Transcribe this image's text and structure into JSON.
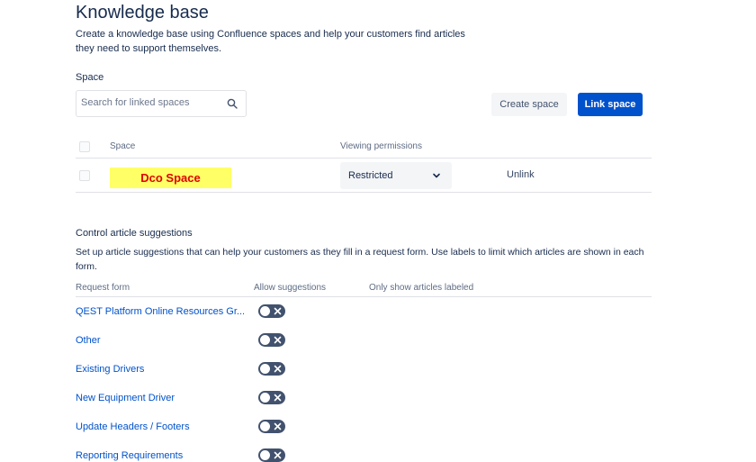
{
  "page": {
    "title": "Knowledge base",
    "description": "Create a knowledge base using Confluence spaces and help your customers find articles they need to support themselves."
  },
  "space": {
    "heading": "Space",
    "search_placeholder": "Search for linked spaces",
    "create_label": "Create space",
    "link_label": "Link space"
  },
  "spaces_table": {
    "headers": {
      "space": "Space",
      "permissions": "Viewing permissions"
    },
    "rows": [
      {
        "name": "Dco Space",
        "permission": "Restricted",
        "action": "Unlink"
      }
    ]
  },
  "suggestions": {
    "title": "Control article suggestions",
    "description": "Set up article suggestions that can help your customers as they fill in a request form. Use labels to limit which articles are shown in each form.",
    "headers": {
      "form": "Request form",
      "allow": "Allow suggestions",
      "labels": "Only show articles labeled"
    },
    "forms": [
      {
        "name": "QEST Platform Online Resources Gr...",
        "allow": false
      },
      {
        "name": "Other",
        "allow": false
      },
      {
        "name": "Existing Drivers",
        "allow": false
      },
      {
        "name": "New Equipment Driver",
        "allow": false
      },
      {
        "name": "Update Headers / Footers",
        "allow": false
      },
      {
        "name": "Reporting Requirements",
        "allow": false
      }
    ]
  },
  "colors": {
    "primary": "#0052cc",
    "highlight": "#ffff66",
    "highlight_text": "#e00000",
    "toggle_off": "#42526e"
  }
}
